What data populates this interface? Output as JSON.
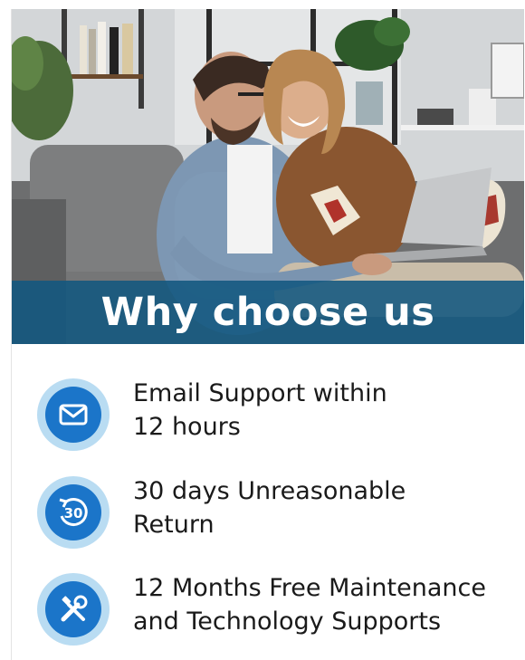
{
  "hero": {
    "title": "Why choose us",
    "photo": "couple-on-sofa-with-laptop"
  },
  "features": [
    {
      "icon": "email-icon",
      "line1": "Email Support within",
      "line2": "12 hours"
    },
    {
      "icon": "return-30-days-icon",
      "line1": "30 days Unreasonable",
      "line2": "Return"
    },
    {
      "icon": "maintenance-tools-icon",
      "line1": "12 Months Free Maintenance",
      "line2": "and Technology Supports"
    }
  ],
  "return_icon_label": "30",
  "colors": {
    "banner": "#125880",
    "icon_circle": "#1b75c9",
    "icon_ring": "#b9dcf2",
    "text": "#1a1a1a"
  }
}
